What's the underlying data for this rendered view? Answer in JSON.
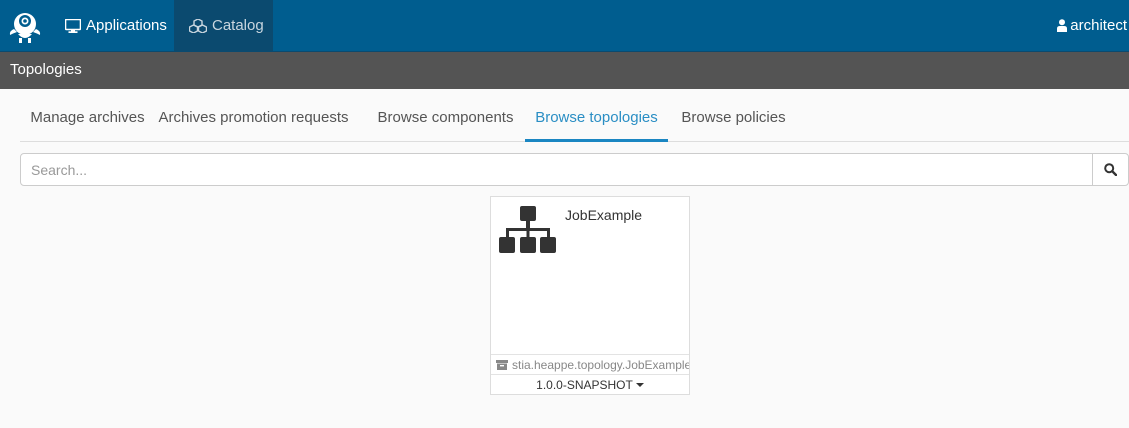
{
  "navbar": {
    "logo_icon": "alien4cloud-logo-icon",
    "applications": {
      "icon": "monitor-icon",
      "label": "Applications"
    },
    "catalog": {
      "icon": "cubes-icon",
      "label": "Catalog"
    },
    "user": {
      "icon": "user-icon",
      "label": "architect"
    }
  },
  "subheader": {
    "title": "Topologies"
  },
  "tabs": [
    {
      "label": "Manage archives",
      "active": false
    },
    {
      "label": "Archives promotion requests",
      "active": false
    },
    {
      "label": "Browse components",
      "active": false
    },
    {
      "label": "Browse topologies",
      "active": true
    },
    {
      "label": "Browse policies",
      "active": false
    }
  ],
  "search": {
    "placeholder": "Search...",
    "value": "",
    "button_icon": "search-icon"
  },
  "topologies": [
    {
      "icon": "sitemap-icon",
      "name": "JobExample",
      "archive_icon": "archive-icon",
      "archive": "stia.heappe.topology.JobExample",
      "version": "1.0.0-SNAPSHOT"
    }
  ],
  "colors": {
    "navbar": "#005d8f",
    "navbar_active": "#0b4a6f",
    "subheader": "#545454",
    "accent": "#1a86c2"
  }
}
